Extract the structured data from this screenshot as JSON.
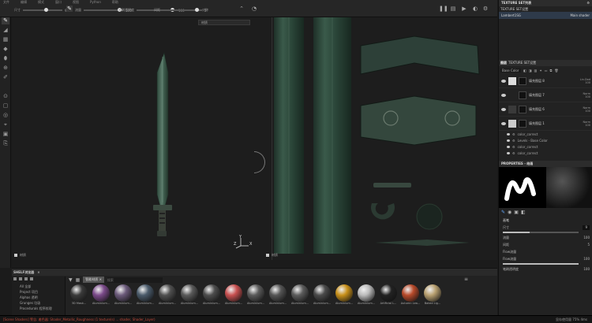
{
  "topbar": {
    "menus": [
      "文件",
      "编辑",
      "模式",
      "窗口",
      "视图",
      "Python",
      "帮助"
    ],
    "sliders": [
      {
        "label": "尺寸",
        "value": "9",
        "level": 0.6
      },
      {
        "label": "流量",
        "value": "100",
        "level": 0.95
      },
      {
        "label": "笔刷透明度",
        "value": "100",
        "level": 0.95
      },
      {
        "label": "间距",
        "value": "5",
        "level": 0.9
      },
      {
        "label": "对称",
        "value": "",
        "level": 0
      }
    ]
  },
  "viewport3d": {
    "dropdown": "材质",
    "footer_label": "材质",
    "axis": {
      "x": "X",
      "y": "Y",
      "z": "Z"
    }
  },
  "viewport2d": {
    "footer_label": "材质"
  },
  "shelf": {
    "title": "SHELF浏览器",
    "categories": [
      "All 全部",
      "Project 项目",
      "Alphas 透明",
      "Grunges 垃圾",
      "Procedurals 程序纹理"
    ],
    "search_placeholder": "搜索",
    "filter_chip": "智能材质",
    "materials": [
      {
        "name": "3D Mask...",
        "color": "#3a3a3a"
      },
      {
        "name": "Aluminium...",
        "color": "#7b4a8a"
      },
      {
        "name": "Aluminium...",
        "color": "#6b5a7a"
      },
      {
        "name": "Aluminium...",
        "color": "#4a5a6a"
      },
      {
        "name": "Aluminium...",
        "color": "#505050"
      },
      {
        "name": "Aluminium...",
        "color": "#5a5a5a"
      },
      {
        "name": "Aluminium...",
        "color": "#4d4d4d"
      },
      {
        "name": "Aluminium...",
        "color": "#c85050"
      },
      {
        "name": "Aluminium...",
        "color": "#5a5a5a"
      },
      {
        "name": "Aluminium...",
        "color": "#555"
      },
      {
        "name": "Aluminium...",
        "color": "#5c5c5c"
      },
      {
        "name": "Aluminium...",
        "color": "#4a4a4a"
      },
      {
        "name": "Aluminium...",
        "color": "#c8901a"
      },
      {
        "name": "Aluminium...",
        "color": "#bbb"
      },
      {
        "name": "Artificial L...",
        "color": "#222"
      },
      {
        "name": "Autumn Lea...",
        "color": "#b84a2a"
      },
      {
        "name": "Baked Lig...",
        "color": "#b8a070"
      }
    ]
  },
  "status": {
    "message": "[Scene Shaders] 警告: 着色器: Shader_Metallic_Roughness (1 texture(s) ... shader, Shader_Layer)",
    "right": "显存使用量 75% 4ms"
  },
  "right_panel": {
    "texture_set_list_title": "TEXTURE SET列表",
    "texture_set_settings_title": "TEXTURE SET设置",
    "texture_set": {
      "name": "Lambert1SG",
      "shader": "Main shader"
    },
    "layers_tabs": [
      "图层",
      "TEXTURE SET设置"
    ],
    "channel": "Base Color",
    "layers": [
      {
        "name": "填充图层 8",
        "blend": "Lin.Dod",
        "opacity": "100",
        "thumb": "#ddd"
      },
      {
        "name": "填充图层 7",
        "blend": "Norm",
        "opacity": "100",
        "thumb": "#222"
      },
      {
        "name": "填充图层 6",
        "blend": "Norm",
        "opacity": "100",
        "thumb": "#3a3a3a"
      },
      {
        "name": "填充图层 1",
        "blend": "Norm",
        "opacity": "100",
        "thumb": "#ccc"
      }
    ],
    "effects": [
      "color_correct",
      "Levels - Base Color",
      "color_correct",
      "color_correct"
    ],
    "properties_title": "PROPERTIES - 绘画",
    "brush_section": "画笔",
    "size_label": "尺寸",
    "size_value": "9",
    "size_level": 0.35,
    "flow_label": "流量",
    "flow_value": "100",
    "spacing_label": "间距",
    "spacing_value": "5",
    "flow_section": "Flow流量",
    "flow_sub_label": "Flow流量",
    "flow_sub_value": "100",
    "opacity_label": "笔刷透明度",
    "opacity_value": "100"
  }
}
